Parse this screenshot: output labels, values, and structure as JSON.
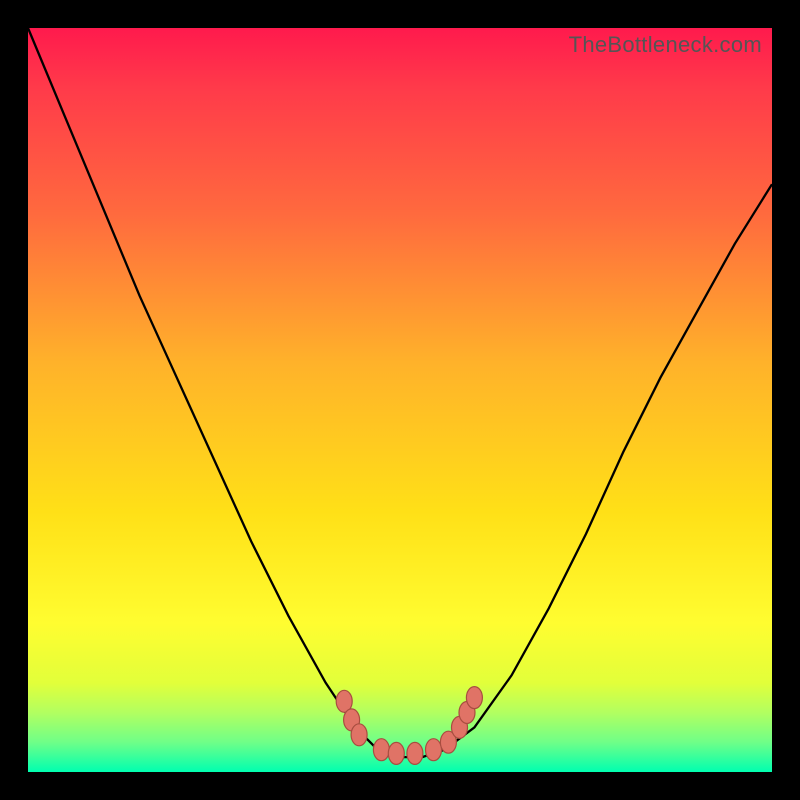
{
  "watermark": "TheBottleneck.com",
  "chart_data": {
    "type": "line",
    "title": "",
    "xlabel": "",
    "ylabel": "",
    "xlim": [
      0,
      1
    ],
    "ylim": [
      0,
      1
    ],
    "series": [
      {
        "name": "curve",
        "x": [
          0.0,
          0.05,
          0.1,
          0.15,
          0.2,
          0.25,
          0.3,
          0.35,
          0.4,
          0.44,
          0.47,
          0.5,
          0.53,
          0.56,
          0.6,
          0.65,
          0.7,
          0.75,
          0.8,
          0.85,
          0.9,
          0.95,
          1.0
        ],
        "y": [
          1.0,
          0.88,
          0.76,
          0.64,
          0.53,
          0.42,
          0.31,
          0.21,
          0.12,
          0.06,
          0.03,
          0.02,
          0.02,
          0.03,
          0.06,
          0.13,
          0.22,
          0.32,
          0.43,
          0.53,
          0.62,
          0.71,
          0.79
        ]
      }
    ],
    "markers": {
      "name": "valley-markers",
      "x": [
        0.425,
        0.435,
        0.445,
        0.475,
        0.495,
        0.52,
        0.545,
        0.565,
        0.58,
        0.59,
        0.6
      ],
      "y": [
        0.095,
        0.07,
        0.05,
        0.03,
        0.025,
        0.025,
        0.03,
        0.04,
        0.06,
        0.08,
        0.1
      ]
    },
    "annotations": []
  },
  "colors": {
    "background": "#000000",
    "curve": "#000000",
    "marker_fill": "#e07366",
    "marker_stroke": "#a84d40"
  }
}
